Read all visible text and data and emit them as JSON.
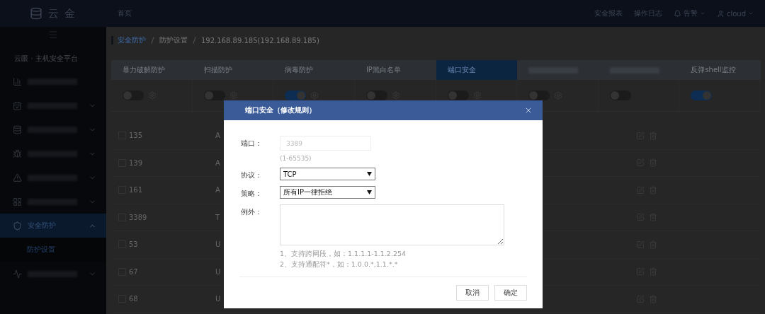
{
  "header": {
    "brand": "云 金",
    "nav": [
      {
        "label": "首页"
      }
    ],
    "actions": [
      {
        "kind": "link",
        "label": "安全报表"
      },
      {
        "kind": "link",
        "label": "操作日志"
      },
      {
        "kind": "alerts",
        "label": "告警"
      },
      {
        "kind": "user",
        "label": "cloud"
      }
    ]
  },
  "sidebar": {
    "title": "云眼 · 主机安全平台",
    "items": [
      {
        "kind": "plain",
        "selected": false
      },
      {
        "kind": "group",
        "selected": false,
        "expanded": false
      },
      {
        "kind": "group",
        "selected": false,
        "expanded": false
      },
      {
        "kind": "group",
        "selected": false,
        "expanded": false
      },
      {
        "kind": "group",
        "selected": false,
        "expanded": false
      },
      {
        "kind": "group",
        "selected": false,
        "expanded": false
      },
      {
        "kind": "group",
        "label": "安全防护",
        "selected": true,
        "expanded": true,
        "children": [
          {
            "label": "防护设置",
            "selected": true
          }
        ]
      },
      {
        "kind": "group",
        "selected": false,
        "expanded": false
      }
    ]
  },
  "breadcrumb": [
    "安全防护",
    "防护设置",
    "192.168.89.185(192.168.89.185)"
  ],
  "tabs": [
    {
      "label": "暴力破解防护",
      "selected": false,
      "on": false,
      "settings": true
    },
    {
      "label": "扫描防护",
      "selected": false,
      "on": false,
      "settings": true
    },
    {
      "label": "病毒防护",
      "selected": false,
      "on": true,
      "settings": true
    },
    {
      "label": "IP黑白名单",
      "selected": false,
      "on": false,
      "settings": true
    },
    {
      "label": "端口安全",
      "selected": true,
      "on": false,
      "settings": true
    },
    {
      "selected": false,
      "on": false,
      "settings": true
    },
    {
      "selected": false,
      "on": false,
      "settings": false
    },
    {
      "label": "反弹shell监控",
      "selected": false,
      "on": true,
      "settings": false
    }
  ],
  "rows": [
    {
      "checked": false,
      "port": "135",
      "column_2": "A"
    },
    {
      "checked": false,
      "port": "139",
      "column_2": "A"
    },
    {
      "checked": false,
      "port": "161",
      "column_2": "A"
    },
    {
      "checked": false,
      "port": "3389",
      "column_2": "T"
    },
    {
      "checked": false,
      "port": "53",
      "column_2": "U"
    },
    {
      "checked": false,
      "port": "67",
      "column_2": "U"
    },
    {
      "checked": false,
      "port": "68",
      "column_2": "U"
    }
  ],
  "modal": {
    "title": "端口安全（修改规则）",
    "fields": [
      {
        "kind": "input",
        "label": "端口：",
        "value": "3389",
        "disabled": true,
        "hint": "(1-65535)"
      },
      {
        "kind": "select",
        "label": "协议：",
        "value": "TCP"
      },
      {
        "kind": "select",
        "label": "策略：",
        "value": "所有IP一律拒绝"
      },
      {
        "kind": "textarea",
        "label": "例外：",
        "notes": [
          "1、支持跨网段，如：1.1.1.1-1.1.2.254",
          "2、支持通配符*，如：1.0.0.*,1.1.*.*"
        ]
      }
    ],
    "buttons": [
      {
        "label": "取消"
      },
      {
        "label": "确定"
      }
    ]
  }
}
